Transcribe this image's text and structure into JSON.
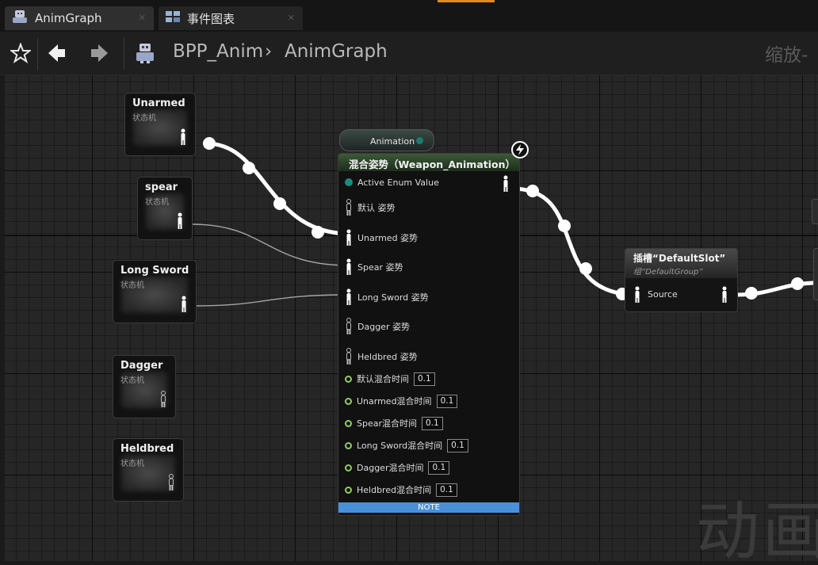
{
  "tabs": [
    {
      "label": "AnimGraph",
      "icon": "anim-blueprint-icon",
      "active": true
    },
    {
      "label": "事件图表",
      "icon": "event-graph-icon",
      "active": false
    }
  ],
  "breadcrumb": {
    "root": "BPP_Anim",
    "separator": "›",
    "current": "AnimGraph"
  },
  "zoom_label": "缩放-",
  "watermark": "动画",
  "state_machines": [
    {
      "title": "Unarmed",
      "subtitle": "状态机"
    },
    {
      "title": "spear",
      "subtitle": "状态机"
    },
    {
      "title": "Long Sword",
      "subtitle": "状态机"
    },
    {
      "title": "Dagger",
      "subtitle": "状态机"
    },
    {
      "title": "Heldbred",
      "subtitle": "状态机"
    }
  ],
  "animation_pill": "Animation",
  "blend_node": {
    "title": "混合姿势（Weapon_Animation）",
    "enum_pin": "Active Enum Value",
    "pose_pins": [
      "默认 姿势",
      "Unarmed 姿势",
      "Spear 姿势",
      "Long Sword 姿势",
      "Dagger 姿势",
      "Heldbred 姿势"
    ],
    "blend_times": [
      {
        "label": "默认混合时间",
        "value": "0.1"
      },
      {
        "label": "Unarmed混合时间",
        "value": "0.1"
      },
      {
        "label": "Spear混合时间",
        "value": "0.1"
      },
      {
        "label": "Long Sword混合时间",
        "value": "0.1"
      },
      {
        "label": "Dagger混合时间",
        "value": "0.1"
      },
      {
        "label": "Heldbred混合时间",
        "value": "0.1"
      }
    ],
    "note": "NOTE"
  },
  "slot_node": {
    "title": "插槽“DefaultSlot”",
    "subtitle": "组“DefaultGroup”",
    "source_pin": "Source"
  },
  "colors": {
    "tab_accent": "#e08a1e",
    "blend_header": "#3b5a37",
    "note_bar": "#4a90d9",
    "enum_pin": "#1d8a80",
    "blend_time_pin": "#8fce66",
    "active_wire": "#ffffff",
    "inactive_wire": "#9a9a9a"
  }
}
